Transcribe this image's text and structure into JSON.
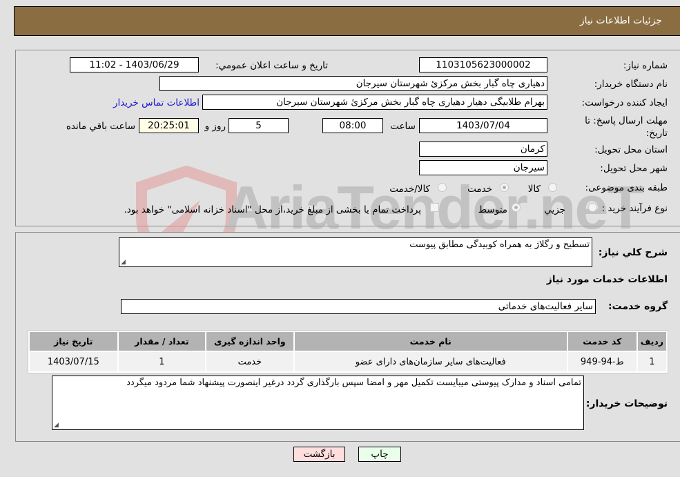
{
  "header": {
    "title": "جزئيات اطلاعات نياز"
  },
  "fields": {
    "need_number": {
      "label": "شماره نياز:",
      "value": "1103105623000002"
    },
    "announce_datetime": {
      "label": "تاريخ و ساعت اعلان عمومي:",
      "value": "1403/06/29 - 11:02"
    },
    "buyer_org": {
      "label": "نام دستگاه خريدار:",
      "value": "دهیاری چاه گبار بخش مرکزئ شهرستان سیرجان"
    },
    "requester": {
      "label": "ايجاد کننده درخواست:",
      "value": "بهرام طلابیگی دهیار دهیاری چاه گبار بخش مرکزئ شهرستان سیرجان",
      "contact_link": "اطلاعات تماس خريدار"
    },
    "deadline": {
      "label": "مهلت ارسال پاسخ: تا تاريخ:",
      "date": "1403/07/04",
      "time_label": "ساعت",
      "time": "08:00",
      "days": "5",
      "days_label": "روز و",
      "remaining": "20:25:01",
      "remaining_label": "ساعت باقي مانده"
    },
    "province": {
      "label": "استان محل تحويل:",
      "value": "کرمان"
    },
    "city": {
      "label": "شهر محل تحويل:",
      "value": "سیرجان"
    },
    "category": {
      "label": "طبقه بندی موضوعی:",
      "options": [
        "کالا",
        "خدمت",
        "کالا/خدمت"
      ],
      "selected": "خدمت"
    },
    "process": {
      "label": "نوع فرآيند خريد :",
      "options": [
        "جزيي",
        "متوسط"
      ],
      "selected": "متوسط",
      "treasury_note": "پرداخت تمام يا بخشی از مبلغ خريد،از محل \"اسناد خزانه اسلامی\" خواهد بود."
    }
  },
  "description": {
    "label": "شرح کلي نياز:",
    "value": "تسطیح و رگلاژ به همراه کوبیدگی مطابق پیوست"
  },
  "services": {
    "section_title": "اطلاعات خدمات مورد نياز",
    "group_label": "گروه خدمت:",
    "group_value": "ساير فعاليت‌های خدماتی",
    "table": {
      "headers": [
        "رديف",
        "کد خدمت",
        "نام خدمت",
        "واحد اندازه گيری",
        "تعداد / مقدار",
        "تاريخ نياز"
      ],
      "rows": [
        [
          "1",
          "ط-94-949",
          "فعاليت‌های ساير سازمان‌های دارای عضو",
          "خدمت",
          "1",
          "1403/07/15"
        ]
      ]
    }
  },
  "buyer_notes": {
    "label": "توضيحات خريدار:",
    "value": "تمامی اسناد و مدارک پیوستی میبایست تکمیل مهر و امضا سپس بارگذاری گردد درغیر اینصورت پیشنهاد شما مردود میگردد"
  },
  "buttons": {
    "print": "چاپ",
    "back": "بازگشت"
  },
  "watermark": {
    "text": "AriaTender.neT"
  },
  "colors": {
    "header_bg": "#8b6d42",
    "print_bg": "#eaffea",
    "back_bg": "#ffdede",
    "link": "#1a1acc"
  }
}
